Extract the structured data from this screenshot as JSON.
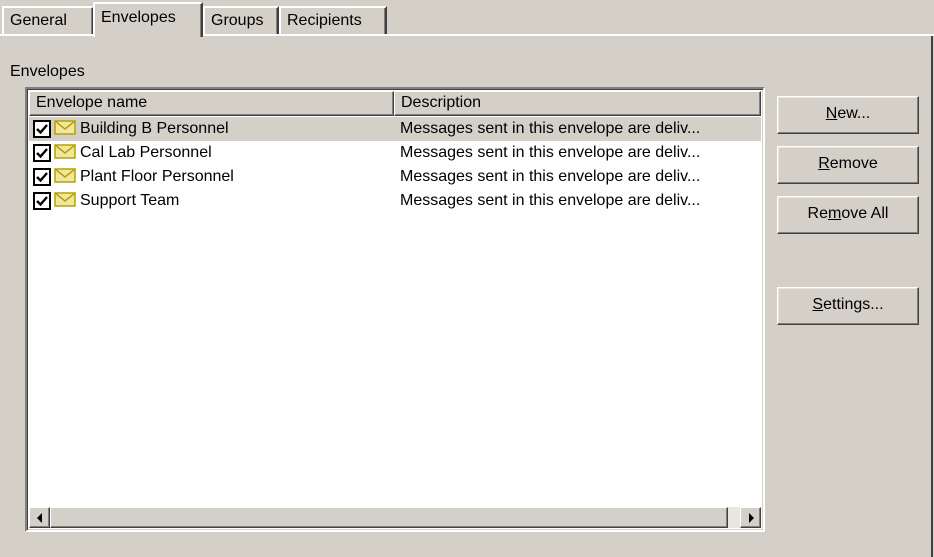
{
  "tabs": [
    {
      "label": "General",
      "active": false
    },
    {
      "label": "Envelopes",
      "active": true
    },
    {
      "label": "Groups",
      "active": false
    },
    {
      "label": "Recipients",
      "active": false
    }
  ],
  "section_label": "Envelopes",
  "list": {
    "columns": [
      "Envelope name",
      "Description"
    ],
    "rows": [
      {
        "name": "Building B Personnel",
        "description": "Messages sent in this envelope are deliv...",
        "checked": true,
        "selected": true
      },
      {
        "name": "Cal Lab Personnel",
        "description": "Messages sent in this envelope are deliv...",
        "checked": true,
        "selected": false
      },
      {
        "name": "Plant Floor Personnel",
        "description": "Messages sent in this envelope are deliv...",
        "checked": true,
        "selected": false
      },
      {
        "name": "Support Team",
        "description": "Messages sent in this envelope are deliv...",
        "checked": true,
        "selected": false
      }
    ],
    "row_icon": "envelope-icon"
  },
  "buttons": {
    "new": {
      "label": "New...",
      "mnemonic_index": 0
    },
    "remove": {
      "label": "Remove",
      "mnemonic_index": 0
    },
    "remove_all": {
      "label": "Remove All",
      "mnemonic_index": 2
    },
    "settings": {
      "label": "Settings...",
      "mnemonic_index": 0
    }
  },
  "colors": {
    "face": "#d4d0c8",
    "envelope_fill": "#f0e8a0",
    "envelope_stroke": "#b8a000"
  }
}
